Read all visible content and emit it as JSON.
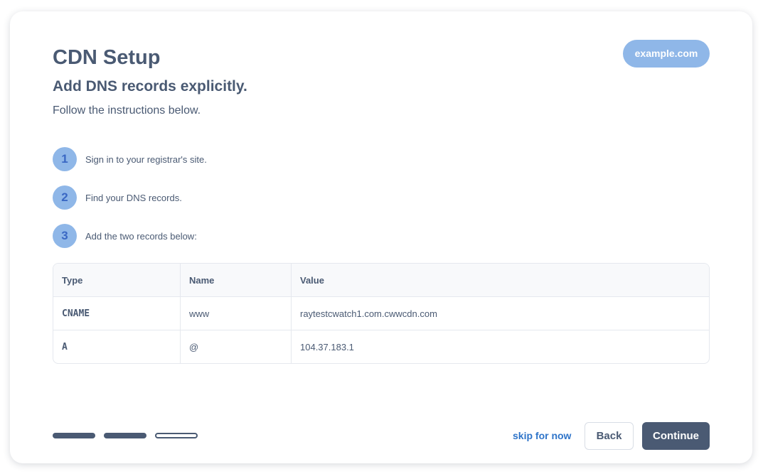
{
  "header": {
    "title": "CDN Setup",
    "subtitle": "Add DNS records explicitly.",
    "instructions": "Follow the instructions below.",
    "domain": "example.com"
  },
  "steps": [
    {
      "number": "1",
      "text": "Sign in to your registrar's site."
    },
    {
      "number": "2",
      "text": "Find your DNS records."
    },
    {
      "number": "3",
      "text": "Add the two records below:"
    }
  ],
  "table": {
    "columns": [
      "Type",
      "Name",
      "Value"
    ],
    "rows": [
      {
        "type": "CNAME",
        "name": "www",
        "value": "raytestcwatch1.com.cwwcdn.com"
      },
      {
        "type": "A",
        "name": "@",
        "value": "104.37.183.1"
      }
    ]
  },
  "progress": {
    "total_steps": 3,
    "completed_steps": 2
  },
  "footer": {
    "skip_label": "skip for now",
    "back_label": "Back",
    "continue_label": "Continue"
  },
  "colors": {
    "primary": "#4a5a73",
    "accent_light": "#8fb7e8",
    "link": "#2e74c9",
    "step_number": "#3a68c4"
  }
}
